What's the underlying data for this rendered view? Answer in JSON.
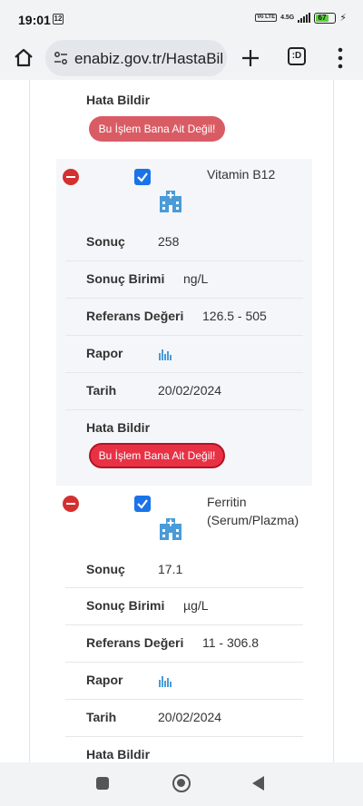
{
  "status_bar": {
    "time": "19:01",
    "alert_badge": "12",
    "volte": "Vo LTE",
    "network": "4.5G",
    "battery": "67"
  },
  "browser": {
    "url": "enabiz.gov.tr/HastaBil",
    "tabs_count": ":D"
  },
  "top_fragment": {
    "error_label": "Hata Bildir",
    "error_button": "Bu İşlem Bana Ait Değil!"
  },
  "tests": [
    {
      "name": "Vitamin B12",
      "name_lines": [
        "Vitamin B12"
      ],
      "result_label": "Sonuç",
      "result": "258",
      "unit_label": "Sonuç Birimi",
      "unit": "ng/L",
      "ref_label": "Referans Değeri",
      "ref": "126.5 - 505",
      "report_label": "Rapor",
      "date_label": "Tarih",
      "date": "20/02/2024",
      "error_label": "Hata Bildir",
      "error_button": "Bu İşlem Bana Ait Değil!"
    },
    {
      "name": "Ferritin (Serum/Plazma)",
      "name_lines": [
        "Ferritin",
        "(Serum/Plazma)"
      ],
      "result_label": "Sonuç",
      "result": "17.1",
      "unit_label": "Sonuç Birimi",
      "unit": "µg/L",
      "ref_label": "Referans Değeri",
      "ref": "11 - 306.8",
      "report_label": "Rapor",
      "date_label": "Tarih",
      "date": "20/02/2024",
      "error_label": "Hata Bildir"
    }
  ],
  "colors": {
    "accent": "#1a73e8",
    "danger": "#d4302f",
    "error_button": "#d95c65",
    "error_button_active": "#e83144",
    "icon_blue": "#4a9bd8"
  }
}
